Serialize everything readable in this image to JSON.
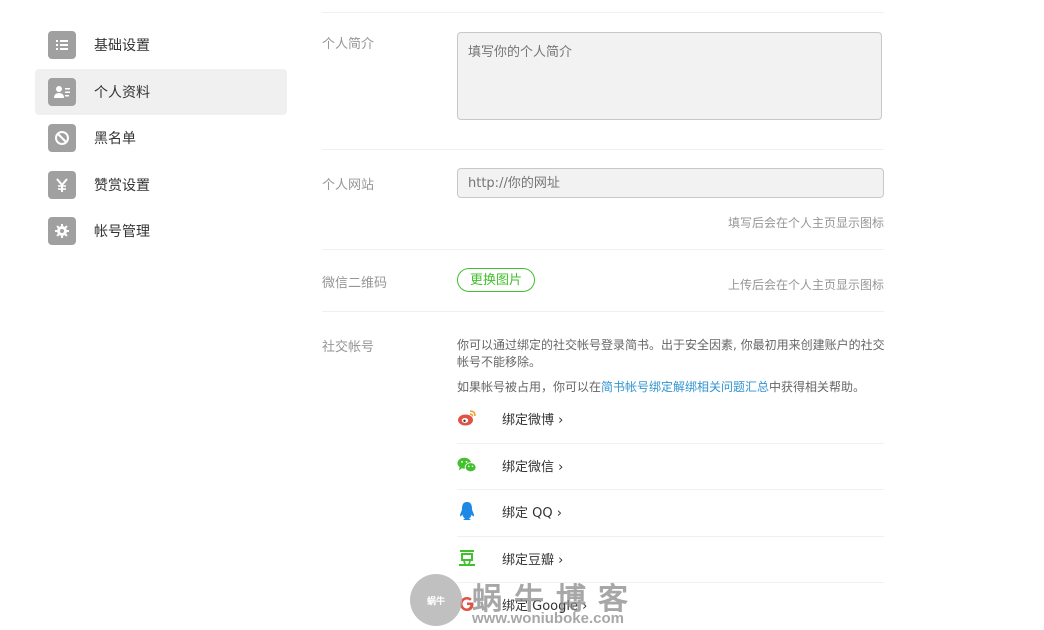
{
  "sidebar": {
    "items": [
      {
        "label": "基础设置",
        "icon": "list-icon",
        "active": false
      },
      {
        "label": "个人资料",
        "icon": "profile-card-icon",
        "active": true
      },
      {
        "label": "黑名单",
        "icon": "block-icon",
        "active": false
      },
      {
        "label": "赞赏设置",
        "icon": "yen-icon",
        "active": false
      },
      {
        "label": "帐号管理",
        "icon": "gear-icon",
        "active": false
      }
    ]
  },
  "profile": {
    "bio_label": "个人简介",
    "bio_placeholder": "填写你的个人简介",
    "website_label": "个人网站",
    "website_placeholder": "http://你的网址",
    "website_hint": "填写后会在个人主页显示图标",
    "wechat_qr_label": "微信二维码",
    "change_image_button": "更换图片",
    "wechat_qr_hint": "上传后会在个人主页显示图标",
    "social_label": "社交帐号",
    "social_desc_line1": "你可以通过绑定的社交帐号登录简书。出于安全因素, 你最初用来创建账户的社交",
    "social_desc_line2": "帐号不能移除。",
    "help_prefix": "如果帐号被占用，你可以在",
    "help_link": "简书帐号绑定解绑相关问题汇总",
    "help_suffix": "中获得相关帮助。"
  },
  "bindings": [
    {
      "label": "绑定微博 ›",
      "icon": "weibo-icon"
    },
    {
      "label": "绑定微信 ›",
      "icon": "wechat-icon"
    },
    {
      "label": "绑定 QQ ›",
      "icon": "qq-icon"
    },
    {
      "label": "绑定豆瓣 ›",
      "icon": "douban-icon"
    },
    {
      "label": "绑定 Google ›",
      "icon": "google-icon"
    }
  ],
  "watermark": {
    "cn": "蜗牛博客",
    "url": "www.woniuboke.com",
    "logo_text": "蜗牛"
  },
  "colors": {
    "accent_green": "#42c02e",
    "link_blue": "#3194d0",
    "sidebar_icon_bg": "#a0a0a0",
    "active_bg": "#f0f0f0"
  }
}
